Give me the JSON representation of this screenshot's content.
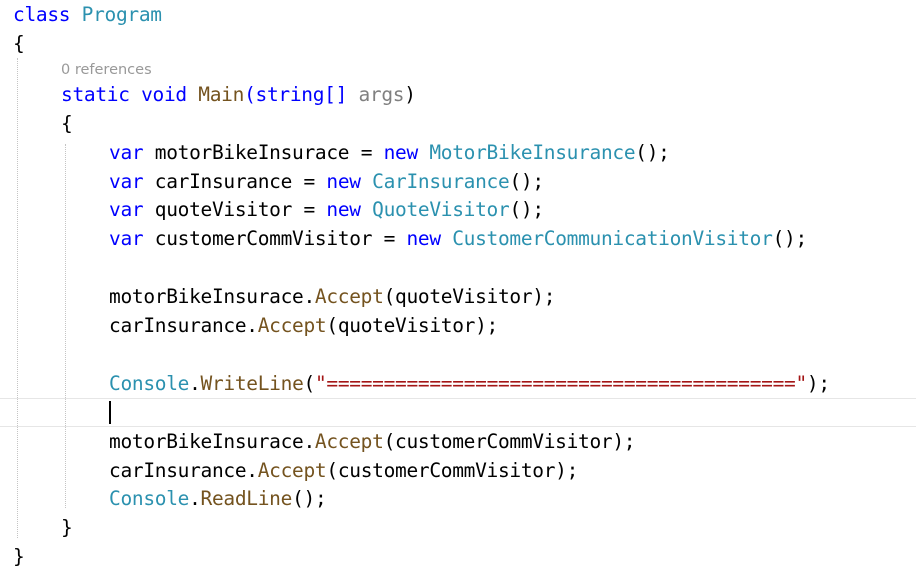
{
  "editor": {
    "class_header": {
      "kw": "class",
      "name": "Program"
    },
    "open_brace": "{",
    "close_brace": "}",
    "codelens": "0 references",
    "main_signature": {
      "modifiers": "static void",
      "name": "Main",
      "params_pre": "(string[] ",
      "param": "args",
      "params_post": ")"
    },
    "decl_motor": {
      "kw": "var",
      "var": " motorBikeInsurace = ",
      "new": "new",
      "type": "MotorBikeInsurance",
      "end": "();"
    },
    "decl_car": {
      "kw": "var",
      "var": " carInsurance = ",
      "new": "new",
      "type": "CarInsurance",
      "end": "();"
    },
    "decl_quote": {
      "kw": "var",
      "var": " quoteVisitor = ",
      "new": "new",
      "type": "QuoteVisitor",
      "end": "();"
    },
    "decl_comm": {
      "kw": "var",
      "var": " customerCommVisitor = ",
      "new": "new",
      "type": "CustomerCommunicationVisitor",
      "end": "();"
    },
    "call1": {
      "obj": "motorBikeInsurace.",
      "method": "Accept",
      "args": "(quoteVisitor);"
    },
    "call2": {
      "obj": "carInsurance.",
      "method": "Accept",
      "args": "(quoteVisitor);"
    },
    "writeline": {
      "type": "Console",
      "dot": ".",
      "method": "WriteLine",
      "open": "(",
      "str": "\"=========================================\"",
      "close": ");"
    },
    "call3": {
      "obj": "motorBikeInsurace.",
      "method": "Accept",
      "args": "(customerCommVisitor);"
    },
    "call4": {
      "obj": "carInsurance.",
      "method": "Accept",
      "args": "(customerCommVisitor);"
    },
    "readline": {
      "type": "Console",
      "dot": ".",
      "method": "ReadLine",
      "end": "();"
    }
  },
  "colors": {
    "keyword": "#0000ff",
    "type": "#2b91af",
    "method": "#74531f",
    "string": "#a31515",
    "text": "#000000",
    "codelens": "#999999"
  }
}
